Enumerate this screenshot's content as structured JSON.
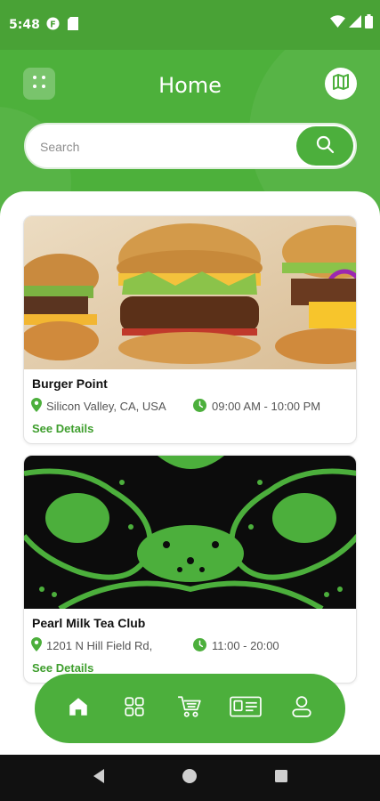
{
  "status": {
    "time": "5:48"
  },
  "header": {
    "title": "Home"
  },
  "search": {
    "placeholder": "Search"
  },
  "restaurants": [
    {
      "name": "Burger Point",
      "location": "Silicon Valley, CA, USA",
      "hours": "09:00 AM - 10:00 PM",
      "link": "See Details"
    },
    {
      "name": "Pearl Milk Tea Club",
      "location": "1201 N Hill Field Rd,",
      "hours": "11:00 - 20:00",
      "link": "See Details"
    }
  ],
  "nav": [
    "home-icon",
    "categories-icon",
    "cart-icon",
    "membership-card-icon",
    "profile-icon"
  ],
  "colors": {
    "primary": "#4caf3c",
    "link": "#3e9e2d"
  }
}
